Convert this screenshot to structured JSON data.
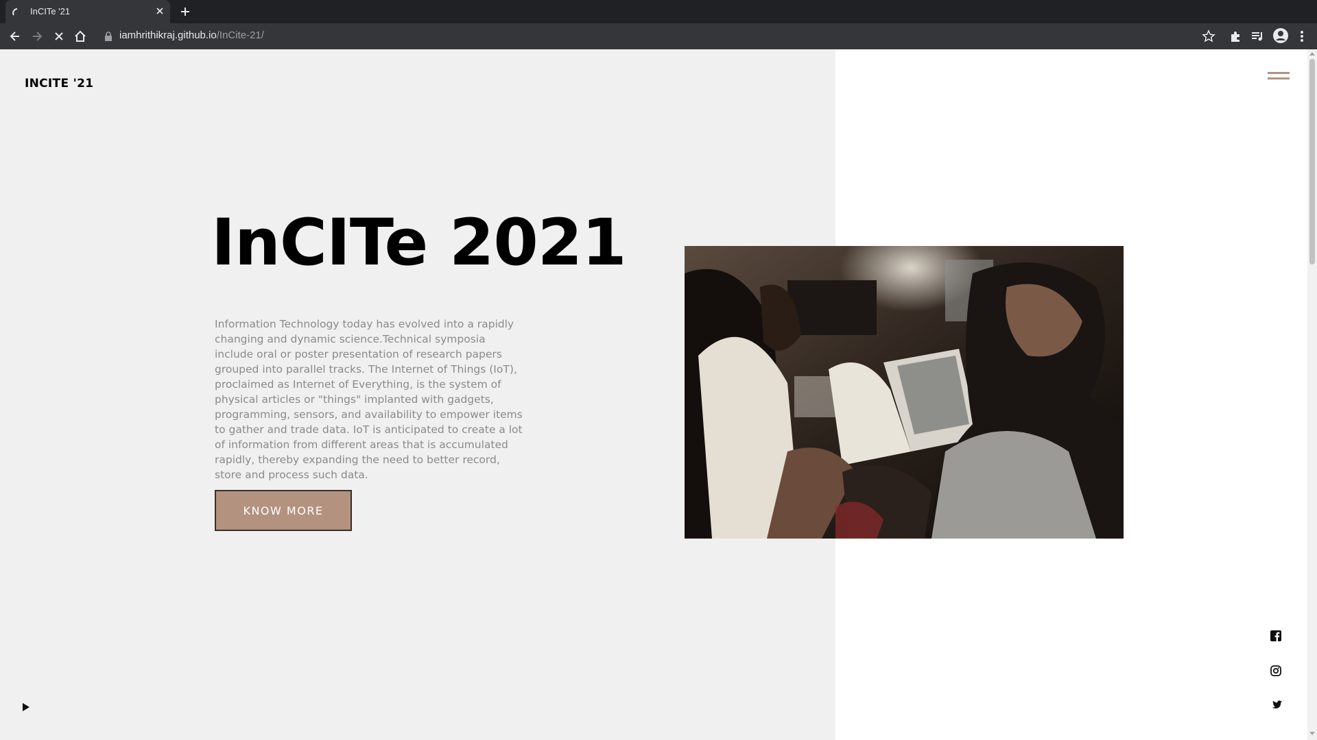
{
  "browser": {
    "tab_title": "InCITe '21",
    "url_domain": "iamhrithikraj.github.io",
    "url_path": "/InCite-21/"
  },
  "site": {
    "logo": "INCITE '21",
    "hero_title": "InCITe 2021",
    "hero_description": "Information Technology today has evolved into a rapidly changing and dynamic science.Technical symposia include oral or poster presentation of research papers grouped into parallel tracks. The Internet of Things (IoT), proclaimed as Internet of Everything, is the system of physical articles or \"things\" implanted with gadgets, programming, sensors, and availability to empower items to gather and trade data. IoT is anticipated to create a lot of information from different areas that is accumulated rapidly, thereby expanding the need to better record, store and process such data.",
    "cta_label": "KNOW MORE"
  },
  "colors": {
    "accent": "#b3927f",
    "left_bg": "#f0f0f0",
    "right_bg": "#ffffff",
    "chrome_dark": "#35363a"
  },
  "icons": {
    "menu": "hamburger-menu-icon",
    "social": [
      "facebook-icon",
      "instagram-icon",
      "twitter-icon"
    ],
    "player": "play-icon"
  }
}
